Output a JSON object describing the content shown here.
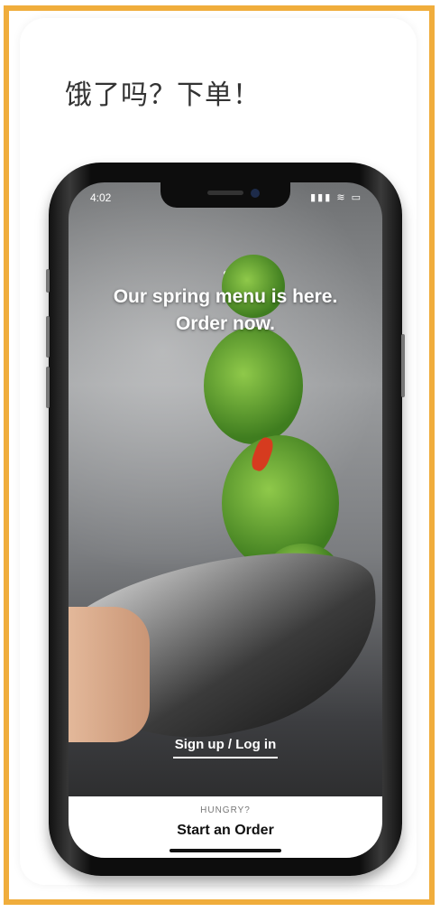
{
  "headline": "饿了吗？下单！",
  "phone": {
    "status_time": "4:02",
    "status_icons": "▮▮▮ ≋ ▭"
  },
  "hero": {
    "line1": "Our spring menu is here.",
    "line2": "Order now."
  },
  "auth_link": "Sign up / Log in",
  "bottom_sheet": {
    "eyebrow": "HUNGRY?",
    "cta": "Start an Order"
  },
  "colors": {
    "frame_border": "#f0ad3c",
    "cta_text": "#111111"
  }
}
